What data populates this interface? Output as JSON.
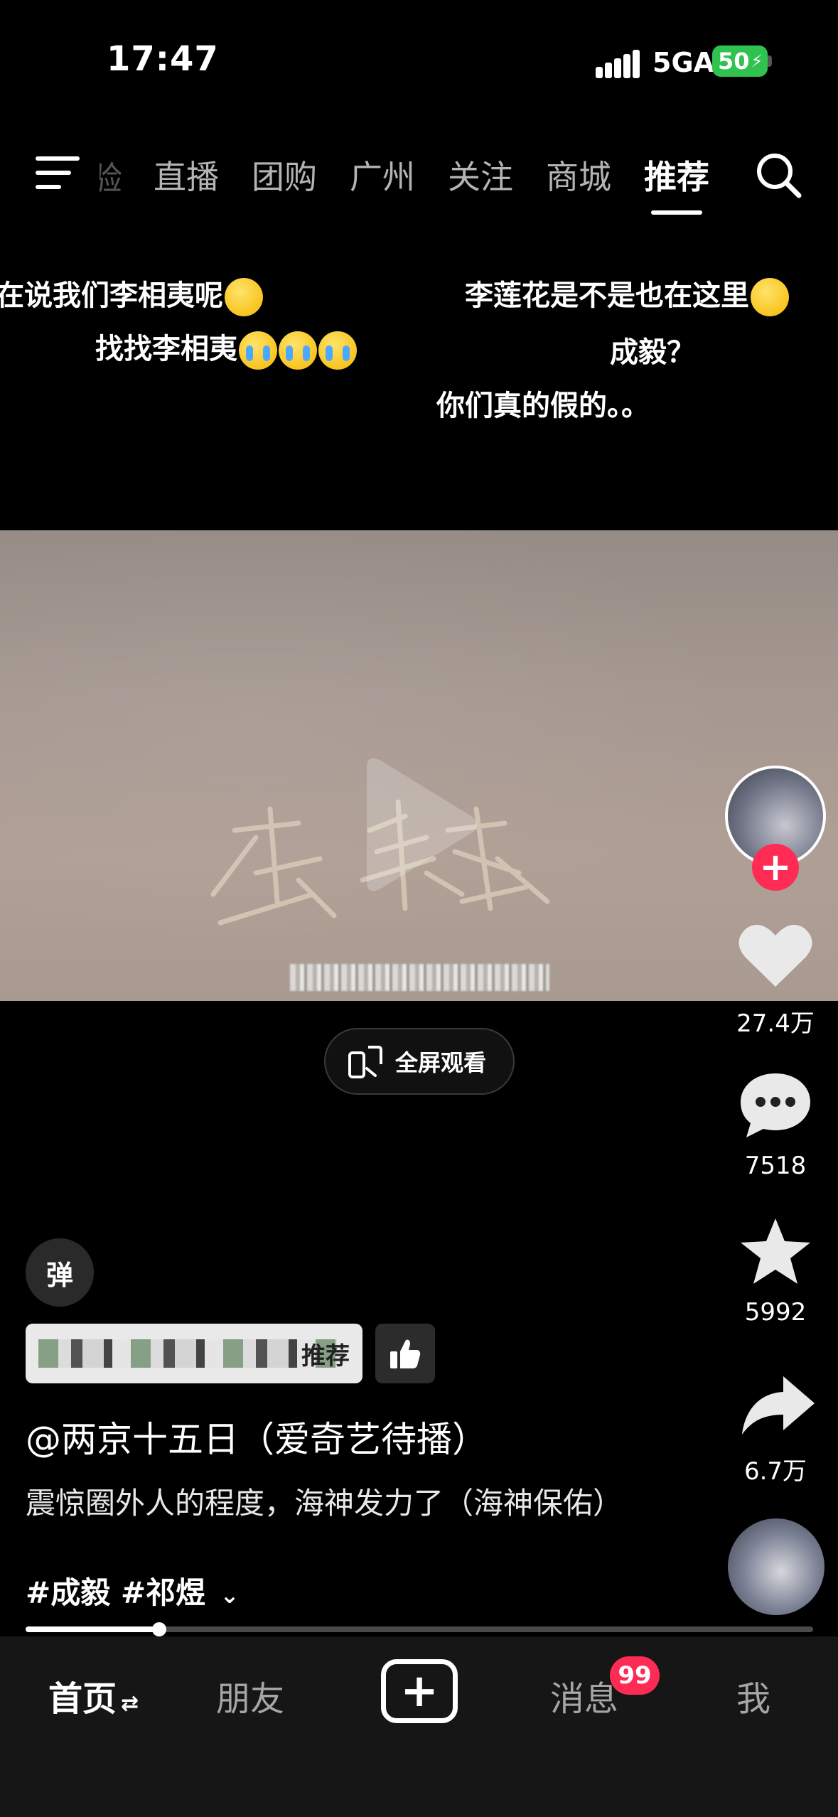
{
  "status": {
    "time": "17:47",
    "network": "5GA",
    "battery": "50"
  },
  "nav": {
    "partial_tab": "经验",
    "tabs": [
      "直播",
      "团购",
      "广州",
      "关注",
      "商城",
      "推荐"
    ],
    "active_tab": "推荐"
  },
  "danmaku": [
    "在说我们李相夷呢",
    "找找李相夷",
    "李莲花是不是也在这里",
    "成毅？",
    "你们真的假的。。"
  ],
  "video": {
    "fullscreen_label": "全屏观看"
  },
  "rail": {
    "likes": "27.4万",
    "comments": "7518",
    "favorites": "5992",
    "shares": "6.7万",
    "follow_symbol": "+"
  },
  "info": {
    "danmu_toggle": "弹",
    "recommend_label": "推荐",
    "author": "@两京十五日（爱奇艺待播）",
    "description": "震惊圈外人的程度，海神发力了（海神保佑）",
    "hashtags": "#成毅 #祁煜",
    "progress": 0.17
  },
  "tabbar": {
    "home": "首页",
    "friends": "朋友",
    "create": "+",
    "messages": "消息",
    "messages_badge": "99",
    "me": "我"
  },
  "colors": {
    "accent": "#fe2c55",
    "battery": "#2fc24f",
    "background": "#000000"
  }
}
